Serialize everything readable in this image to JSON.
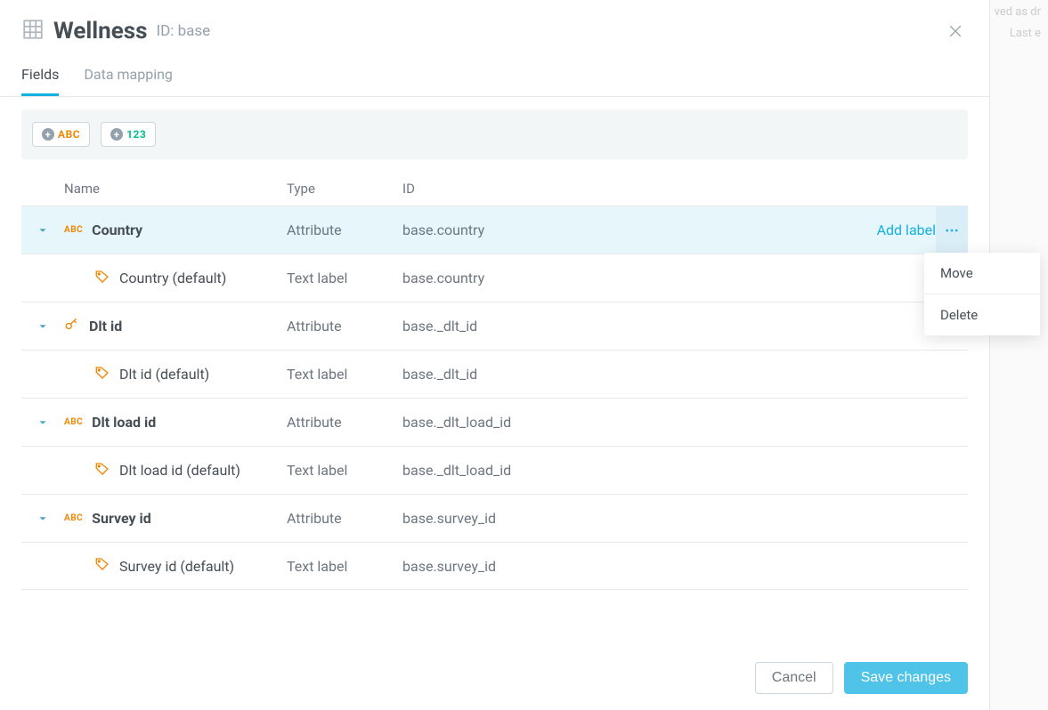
{
  "backdrop": {
    "hint1": "ved as dr",
    "hint2": "Last e"
  },
  "header": {
    "title": "Wellness",
    "subtitle": "ID: base"
  },
  "tabs": {
    "fields": "Fields",
    "data_mapping": "Data mapping"
  },
  "toolbar": {
    "abc": "ABC",
    "num": "123"
  },
  "columns": {
    "name": "Name",
    "type": "Type",
    "id": "ID"
  },
  "actions": {
    "add_label": "Add label"
  },
  "context_menu": {
    "move": "Move",
    "delete": "Delete"
  },
  "footer": {
    "cancel": "Cancel",
    "save": "Save changes"
  },
  "rows": {
    "r0": {
      "name": "Country",
      "type": "Attribute",
      "id": "base.country"
    },
    "r1": {
      "name": "Country (default)",
      "type": "Text label",
      "id": "base.country"
    },
    "r2": {
      "name": "Dlt id",
      "type": "Attribute",
      "id": "base._dlt_id"
    },
    "r3": {
      "name": "Dlt id (default)",
      "type": "Text label",
      "id": "base._dlt_id"
    },
    "r4": {
      "name": "Dlt load id",
      "type": "Attribute",
      "id": "base._dlt_load_id"
    },
    "r5": {
      "name": "Dlt load id (default)",
      "type": "Text label",
      "id": "base._dlt_load_id"
    },
    "r6": {
      "name": "Survey id",
      "type": "Attribute",
      "id": "base.survey_id"
    },
    "r7": {
      "name": "Survey id (default)",
      "type": "Text label",
      "id": "base.survey_id"
    }
  }
}
